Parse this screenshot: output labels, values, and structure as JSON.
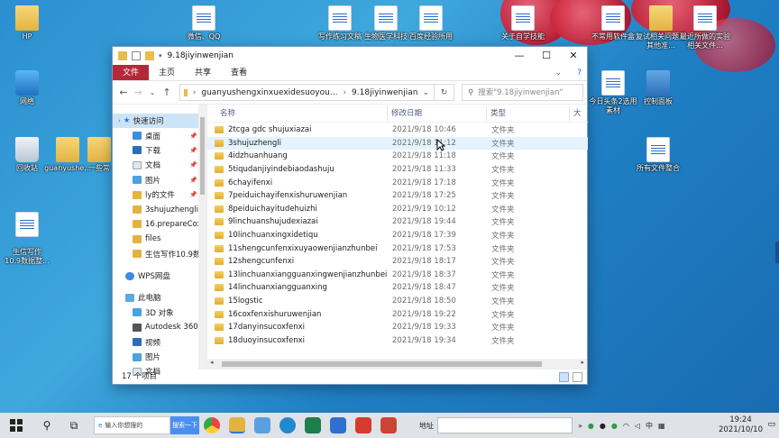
{
  "desktop": {
    "icons_left": [
      {
        "label": "HP",
        "kind": "user"
      },
      {
        "label": "网络",
        "kind": "pc"
      },
      {
        "label": "回收站",
        "kind": "bin"
      },
      {
        "label": "guanyushe...",
        "kind": "folder"
      },
      {
        "label": "一些常",
        "kind": "folder"
      },
      {
        "label": "生信写作\n10.9数据整...",
        "kind": "doc"
      }
    ],
    "icons_top": [
      {
        "label": "微信、QQ",
        "kind": "doc"
      },
      {
        "label": "写作练习文稿",
        "kind": "doc"
      },
      {
        "label": "生物医学科技",
        "kind": "doc"
      },
      {
        "label": "百度经验所用",
        "kind": "doc"
      },
      {
        "label": "关于自学技能",
        "kind": "doc"
      }
    ],
    "icons_right": [
      {
        "label": "不常用软件盒",
        "kind": "doc"
      },
      {
        "label": "复试相关问题及其他准...",
        "kind": "doc"
      },
      {
        "label": "最近所做的实验相关文件...",
        "kind": "doc"
      },
      {
        "label": "今日头条2选用素材",
        "kind": "doc"
      },
      {
        "label": "控制面板",
        "kind": "ctrl"
      },
      {
        "label": "所有文件整合",
        "kind": "doc"
      }
    ]
  },
  "window": {
    "title": "9.18jiyinwenjian",
    "controls": {
      "minimize": "—",
      "maximize": "☐",
      "close": "✕"
    },
    "ribbon_tabs": [
      "文件",
      "主页",
      "共享",
      "查看"
    ],
    "nav": {
      "back": "←",
      "forward": "→",
      "dropdown": "⌄",
      "up": "↑",
      "refresh": "↻"
    },
    "address": {
      "segments": [
        "guanyushengxinxuexidesuoyou...",
        "9.18jiyinwenjian"
      ],
      "chevron": "›"
    },
    "search_placeholder": "搜索\"9.18jiyinwenjian\"",
    "navpane": {
      "quick_access": "快速访问",
      "quick_items": [
        "桌面",
        "下载",
        "文档",
        "图片",
        "ly的文件",
        "3shujuzhengli",
        "16.prepareCox",
        "files",
        "生信写作10.9数据"
      ],
      "wps": "WPS网盘",
      "this_pc": "此电脑",
      "pc_items": [
        "3D 对象",
        "Autodesk 360",
        "视频",
        "图片",
        "文档"
      ]
    },
    "columns": {
      "name": "名称",
      "date": "修改日期",
      "type": "类型",
      "extra": "大"
    },
    "files": [
      {
        "name": "2tcga gdc shujuxiazai",
        "date": "2021/9/18 10:46",
        "type": "文件夹"
      },
      {
        "name": "3shujuzhengli",
        "date": "2021/9/18 11:12",
        "type": "文件夹"
      },
      {
        "name": "4idzhuanhuang",
        "date": "2021/9/18 11:18",
        "type": "文件夹"
      },
      {
        "name": "5tiqudanjiyindebiaodashuju",
        "date": "2021/9/18 11:33",
        "type": "文件夹"
      },
      {
        "name": "6chayifenxi",
        "date": "2021/9/18 17:18",
        "type": "文件夹"
      },
      {
        "name": "7peiduichayifenxishuruwenjian",
        "date": "2021/9/18 17:25",
        "type": "文件夹"
      },
      {
        "name": "8peiduichayitudehuizhi",
        "date": "2021/9/19 10:12",
        "type": "文件夹"
      },
      {
        "name": "9linchuanshujudexiazai",
        "date": "2021/9/18 19:44",
        "type": "文件夹"
      },
      {
        "name": "10linchuanxingxidetiqu",
        "date": "2021/9/18 17:39",
        "type": "文件夹"
      },
      {
        "name": "11shengcunfenxixuyaowenjianzhunbei",
        "date": "2021/9/18 17:53",
        "type": "文件夹"
      },
      {
        "name": "12shengcunfenxi",
        "date": "2021/9/18 18:17",
        "type": "文件夹"
      },
      {
        "name": "13linchuanxiangguanxingwenjianzhunbei",
        "date": "2021/9/18 18:37",
        "type": "文件夹"
      },
      {
        "name": "14linchuanxiangguanxing",
        "date": "2021/9/18 18:47",
        "type": "文件夹"
      },
      {
        "name": "15logstic",
        "date": "2021/9/18 18:50",
        "type": "文件夹"
      },
      {
        "name": "16coxfenxishuruwenjian",
        "date": "2021/9/18 19:22",
        "type": "文件夹"
      },
      {
        "name": "17danyinsucoxfenxi",
        "date": "2021/9/18 19:33",
        "type": "文件夹"
      },
      {
        "name": "18duoyinsucoxfenxi",
        "date": "2021/9/18 19:34",
        "type": "文件夹"
      }
    ],
    "status": "17 个项目"
  },
  "taskbar": {
    "search_placeholder": "输入你想搜的",
    "search_button": "搜索一下",
    "address_label": "地址",
    "tray_ime": "中",
    "clock_time": "19:24",
    "clock_date": "2021/10/10"
  },
  "colors": {
    "accent": "#1a6cc0",
    "file_tab": "#b3293a",
    "folder": "#e3b340"
  }
}
